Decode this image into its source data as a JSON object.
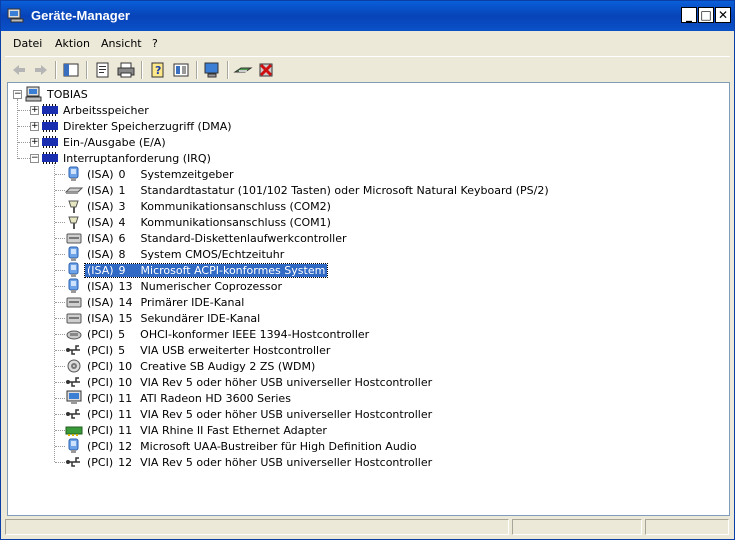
{
  "window": {
    "title": "Geräte-Manager"
  },
  "menu": [
    {
      "label": "Datei"
    },
    {
      "label": "Aktion"
    },
    {
      "label": "Ansicht"
    },
    {
      "label": "?"
    }
  ],
  "tree": {
    "root": "TOBIAS",
    "categories": [
      {
        "label": "Arbeitsspeicher",
        "expanded": false
      },
      {
        "label": "Direkter Speicherzugriff (DMA)",
        "expanded": false
      },
      {
        "label": "Ein-/Ausgabe (E/A)",
        "expanded": false
      },
      {
        "label": "Interruptanforderung (IRQ)",
        "expanded": true
      }
    ],
    "irq_items": [
      {
        "bus": "(ISA)",
        "irq": "0",
        "name": "Systemzeitgeber",
        "icon": "system-icon"
      },
      {
        "bus": "(ISA)",
        "irq": "1",
        "name": "Standardtastatur (101/102 Tasten) oder Microsoft Natural Keyboard (PS/2)",
        "icon": "keyboard-icon"
      },
      {
        "bus": "(ISA)",
        "irq": "3",
        "name": "Kommunikationsanschluss (COM2)",
        "icon": "port-icon"
      },
      {
        "bus": "(ISA)",
        "irq": "4",
        "name": "Kommunikationsanschluss (COM1)",
        "icon": "port-icon"
      },
      {
        "bus": "(ISA)",
        "irq": "6",
        "name": "Standard-Diskettenlaufwerkcontroller",
        "icon": "controller-icon"
      },
      {
        "bus": "(ISA)",
        "irq": "8",
        "name": "System CMOS/Echtzeituhr",
        "icon": "system-icon"
      },
      {
        "bus": "(ISA)",
        "irq": "9",
        "name": "Microsoft ACPI-konformes System",
        "icon": "system-icon",
        "selected": true
      },
      {
        "bus": "(ISA)",
        "irq": "13",
        "name": "Numerischer Coprozessor",
        "icon": "system-icon"
      },
      {
        "bus": "(ISA)",
        "irq": "14",
        "name": "Primärer IDE-Kanal",
        "icon": "controller-icon"
      },
      {
        "bus": "(ISA)",
        "irq": "15",
        "name": "Sekundärer IDE-Kanal",
        "icon": "controller-icon"
      },
      {
        "bus": "(PCI)",
        "irq": "5",
        "name": "OHCI-konformer IEEE 1394-Hostcontroller",
        "icon": "firewire-icon"
      },
      {
        "bus": "(PCI)",
        "irq": "5",
        "name": "VIA USB erweiterter Hostcontroller",
        "icon": "usb-icon"
      },
      {
        "bus": "(PCI)",
        "irq": "10",
        "name": "Creative SB Audigy 2 ZS (WDM)",
        "icon": "sound-icon"
      },
      {
        "bus": "(PCI)",
        "irq": "10",
        "name": "VIA Rev 5 oder höher USB universeller Hostcontroller",
        "icon": "usb-icon"
      },
      {
        "bus": "(PCI)",
        "irq": "11",
        "name": "ATI Radeon HD 3600 Series",
        "icon": "display-icon"
      },
      {
        "bus": "(PCI)",
        "irq": "11",
        "name": "VIA Rev 5 oder höher USB universeller Hostcontroller",
        "icon": "usb-icon"
      },
      {
        "bus": "(PCI)",
        "irq": "11",
        "name": "VIA Rhine II Fast Ethernet Adapter",
        "icon": "network-icon"
      },
      {
        "bus": "(PCI)",
        "irq": "12",
        "name": "Microsoft UAA-Bustreiber für High Definition Audio",
        "icon": "system-icon"
      },
      {
        "bus": "(PCI)",
        "irq": "12",
        "name": "VIA Rev 5 oder höher USB universeller Hostcontroller",
        "icon": "usb-icon"
      }
    ]
  },
  "colors": {
    "titlebar": "#0843b8",
    "selection": "#316ac5",
    "chrome": "#ece9d8"
  }
}
